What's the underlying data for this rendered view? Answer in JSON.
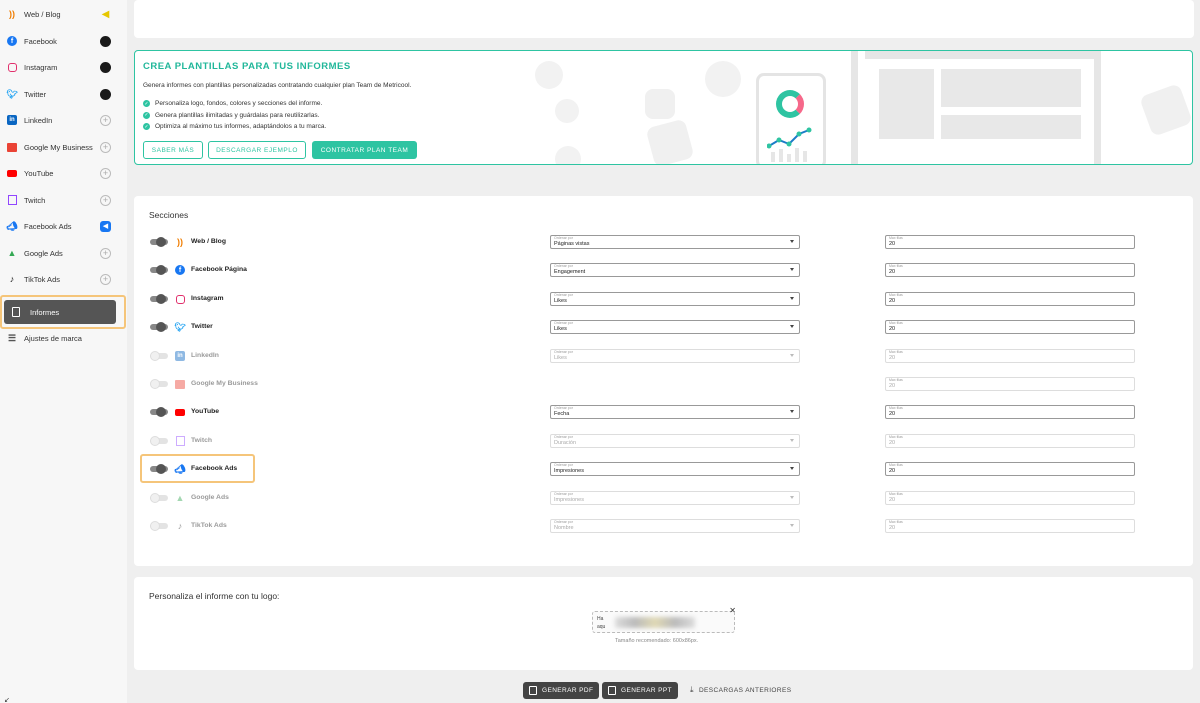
{
  "sidebar": {
    "items": [
      {
        "label": "Web / Blog",
        "icon": "rss-icon",
        "badge": "megaphone-icon"
      },
      {
        "label": "Facebook",
        "icon": "facebook-icon",
        "badge": "connected-icon"
      },
      {
        "label": "Instagram",
        "icon": "instagram-icon",
        "badge": "connected-icon"
      },
      {
        "label": "Twitter",
        "icon": "twitter-icon",
        "badge": "connected-icon"
      },
      {
        "label": "LinkedIn",
        "icon": "linkedin-icon",
        "badge": "add-icon"
      },
      {
        "label": "Google My Business",
        "icon": "gmb-icon",
        "badge": "add-icon"
      },
      {
        "label": "YouTube",
        "icon": "youtube-icon",
        "badge": "add-icon"
      },
      {
        "label": "Twitch",
        "icon": "twitch-icon",
        "badge": "add-icon"
      },
      {
        "label": "Facebook Ads",
        "icon": "facebook-ads-icon",
        "badge": "ads-account-icon"
      },
      {
        "label": "Google Ads",
        "icon": "google-ads-icon",
        "badge": "add-icon"
      },
      {
        "label": "TikTok Ads",
        "icon": "tiktok-icon",
        "badge": "add-icon"
      }
    ],
    "active": {
      "label": "Informes",
      "icon": "report-icon"
    },
    "settings": {
      "label": "Ajustes de marca",
      "icon": "sliders-icon"
    }
  },
  "promo": {
    "title": "CREA PLANTILLAS PARA TUS INFORMES",
    "subtitle": "Genera informes con plantillas personalizadas contratando cualquier plan Team de Metricool.",
    "bullets": [
      "Personaliza logo, fondos, colores y secciones del informe.",
      "Genera plantillas ilimitadas y guárdalas para reutilizarlas.",
      "Optimiza al máximo tus informes, adaptándolos a tu marca."
    ],
    "btn_more": "SABER MÁS",
    "btn_download": "DESCARGAR EJEMPLO",
    "btn_plan": "CONTRATAR PLAN TEAM"
  },
  "sections": {
    "title": "Secciones",
    "order_caption": "Ordenar por",
    "max_caption": "Max filas",
    "rows": [
      {
        "name": "Web / Blog",
        "icon": "rss-icon",
        "enabled": true,
        "order": "Páginas vistas",
        "max": "20"
      },
      {
        "name": "Facebook Página",
        "icon": "facebook-icon",
        "enabled": true,
        "order": "Engagement",
        "max": "20"
      },
      {
        "name": "Instagram",
        "icon": "instagram-icon",
        "enabled": true,
        "order": "Likes",
        "max": "20"
      },
      {
        "name": "Twitter",
        "icon": "twitter-icon",
        "enabled": true,
        "order": "Likes",
        "max": "20"
      },
      {
        "name": "LinkedIn",
        "icon": "linkedin-icon",
        "enabled": false,
        "order": "Likes",
        "max": "20"
      },
      {
        "name": "Google My Business",
        "icon": "gmb-icon",
        "enabled": false,
        "order": null,
        "max": "20"
      },
      {
        "name": "YouTube",
        "icon": "youtube-icon",
        "enabled": true,
        "order": "Fecha",
        "max": "20"
      },
      {
        "name": "Twitch",
        "icon": "twitch-icon",
        "enabled": false,
        "order": "Duración",
        "max": "20"
      },
      {
        "name": "Facebook Ads",
        "icon": "facebook-ads-icon",
        "enabled": true,
        "order": "Impresiones",
        "max": "20"
      },
      {
        "name": "Google Ads",
        "icon": "google-ads-icon",
        "enabled": false,
        "order": "Impresiones",
        "max": "20"
      },
      {
        "name": "TikTok Ads",
        "icon": "tiktok-icon",
        "enabled": false,
        "order": "Nombre",
        "max": "20"
      }
    ]
  },
  "logo": {
    "title": "Personaliza el informe con tu logo:",
    "drop_line1": "Ha",
    "drop_line2": "aqu",
    "hint": "Tamaño recomendado: 600x86px."
  },
  "actions": {
    "pdf": "GENERAR PDF",
    "ppt": "GENERAR PPT",
    "previous": "DESCARGAS ANTERIORES"
  },
  "colors": {
    "accent": "#2ec4a2",
    "highlight": "#f5c57a",
    "active_bg": "#555555"
  }
}
